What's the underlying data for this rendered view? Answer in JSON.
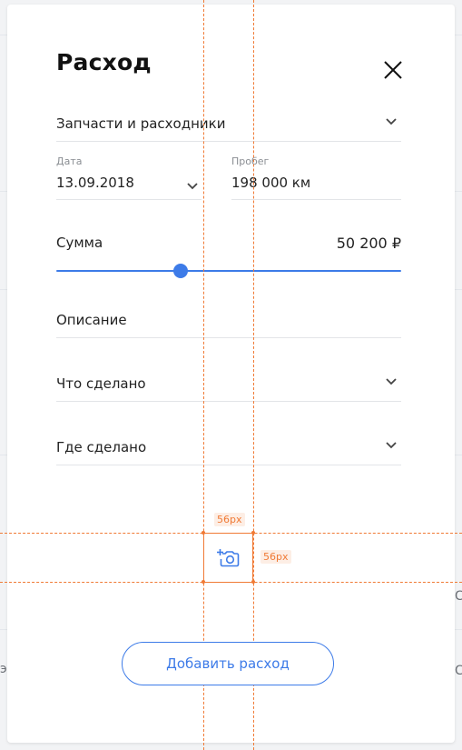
{
  "dialog": {
    "title": "Расход",
    "close_icon": "close-icon"
  },
  "fields": {
    "category": {
      "value": "Запчасти и расходники",
      "icon": "chevron-down-icon"
    },
    "date": {
      "label": "Дата",
      "value": "13.09.2018",
      "icon": "chevron-down-icon"
    },
    "mileage": {
      "label": "Пробег",
      "value": "198 000 км"
    },
    "amount": {
      "label": "Сумма",
      "value": "50 200 ₽",
      "slider_fraction": 0.36
    },
    "description": {
      "placeholder": "Описание"
    },
    "what_done": {
      "placeholder": "Что сделано",
      "icon": "chevron-down-icon"
    },
    "where_done": {
      "placeholder": "Где сделано",
      "icon": "chevron-down-icon"
    }
  },
  "photo": {
    "icon": "add-photo-icon"
  },
  "guides": {
    "width_label": "56px",
    "height_label": "56px"
  },
  "actions": {
    "add_label": "Добавить расход"
  },
  "background": {
    "side_text_right_1": "С",
    "side_text_right_2": "С",
    "side_text_left": "э"
  },
  "colors": {
    "accent": "#3d7be8",
    "guide": "#f07a35",
    "divider": "#e3e5e8",
    "text": "#222222",
    "muted": "#8a8e93"
  }
}
